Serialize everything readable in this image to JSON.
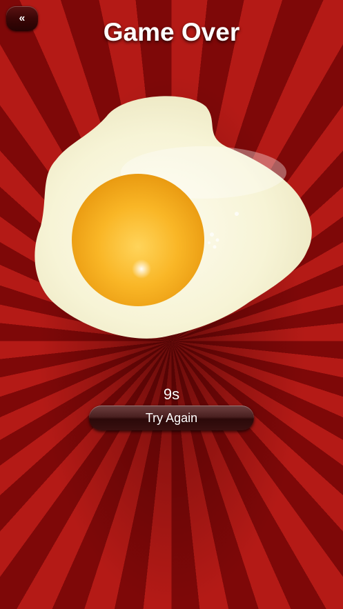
{
  "nav": {
    "back_label": "«"
  },
  "header": {
    "title": "Game Over"
  },
  "result": {
    "time_label": "9s"
  },
  "actions": {
    "try_again_label": "Try Again"
  },
  "colors": {
    "background_ray_light": "#b41a16",
    "background_ray_dark": "#7e0808",
    "egg_white": "#fbf9e8",
    "egg_yolk": "#f7b51f",
    "button_dark": "#3a0606",
    "text": "#ffffff"
  },
  "icons": {
    "back": "double-chevron-left-icon"
  }
}
